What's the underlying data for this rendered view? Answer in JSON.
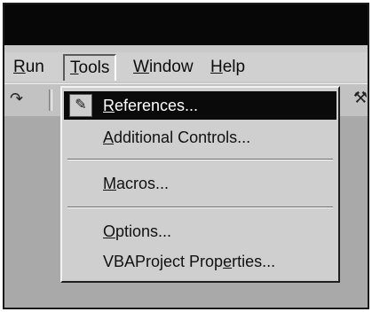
{
  "menubar": {
    "run": {
      "mn": "R",
      "rest": "un"
    },
    "tools": {
      "mn": "T",
      "rest": "ools"
    },
    "window": {
      "mn": "W",
      "rest": "indow"
    },
    "help": {
      "mn": "H",
      "rest": "elp"
    }
  },
  "tools_menu": {
    "references": {
      "mn": "R",
      "rest": "eferences..."
    },
    "additional_controls": {
      "mn": "A",
      "rest": "dditional Controls..."
    },
    "macros": {
      "mn": "M",
      "rest": "acros..."
    },
    "options": {
      "mn": "O",
      "rest": "ptions..."
    },
    "vbaproject_properties": {
      "pre": "VBAProject Prop",
      "mn": "e",
      "post": "rties..."
    }
  },
  "icons": {
    "references": "references-icon",
    "undo": "redo-icon",
    "toolbar_right": "tool-icon"
  },
  "colors": {
    "titlebar": "#070707",
    "menu_face": "#d0d0d0",
    "highlight": "#0a0a0a",
    "highlight_text": "#ffffff"
  }
}
